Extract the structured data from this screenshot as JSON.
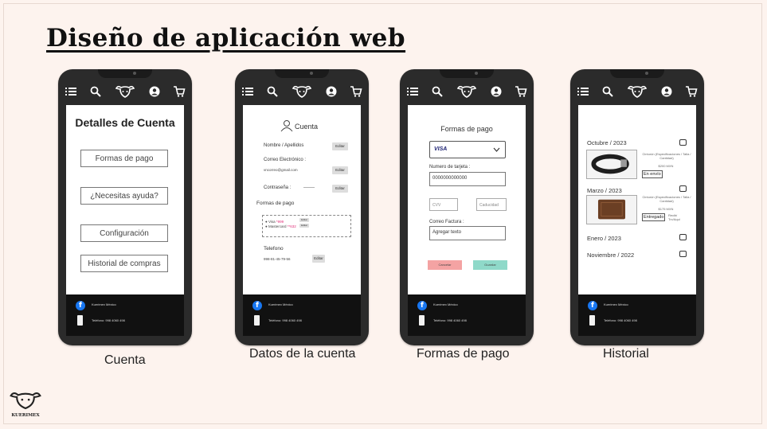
{
  "title": "Diseño de aplicación web",
  "nav_icons": [
    "menu-icon",
    "search-icon",
    "bull-logo-icon",
    "user-icon",
    "cart-icon"
  ],
  "footer": {
    "brand": "Kuerimex México",
    "phone": "Teléfono: 998 4060 498"
  },
  "screens": {
    "cuenta": {
      "caption": "Cuenta",
      "heading": "Detalles de Cuenta",
      "buttons": [
        "Formas de pago",
        "¿Necesitas ayuda?",
        "Configuración",
        "Historial de compras"
      ]
    },
    "datos": {
      "caption": "Datos de la cuenta",
      "heading": "Cuenta",
      "name_label": "Nombre / Apellidos",
      "email_label": "Correo Electrónico :",
      "email_value": "vncorreo@gmail.com",
      "password_label": "Contraseña :",
      "password_value": "-------",
      "edit_label": "Editar",
      "payment_label": "Formas de pago",
      "visa_line": "● Visa ",
      "visa_digits": "*999",
      "mc_line": "● Mastercard ",
      "mc_digits": "**632",
      "phone_label": "Telefono",
      "phone_value": "998-81-45-79-56"
    },
    "pago": {
      "caption": "Formas de pago",
      "heading": "Formas de pago",
      "card_brand": "VISA",
      "card_number_label": "Numero de tarjeta :",
      "card_number_value": "0000000000000",
      "cvv_placeholder": "CVV",
      "expiry_placeholder": "Caducidad",
      "invoice_label": "Correo Factura :",
      "invoice_placeholder": "Agregar texto",
      "cancel_label": "Cancelar",
      "save_label": "Guardar",
      "colors": {
        "cancel": "#f4a3a3",
        "save": "#8fd9c9"
      }
    },
    "historial": {
      "caption": "Historial",
      "months": [
        "Octubre / 2023",
        "Marzo / 2023",
        "Enero / 2023",
        "Noviembre / 2022"
      ],
      "item1": {
        "desc": "Cinturón (Especificaciones / Talla / Cantidad)",
        "price": "$200 MXN",
        "status": "En envío"
      },
      "item2": {
        "desc": "Cinturón (Especificaciones / Talla / Cantidad)",
        "price": "$175 MXN",
        "status": "Entregado",
        "extra": "Recibí Trx/Aqui"
      }
    }
  },
  "brand_logo_text": "KUERIMEX"
}
